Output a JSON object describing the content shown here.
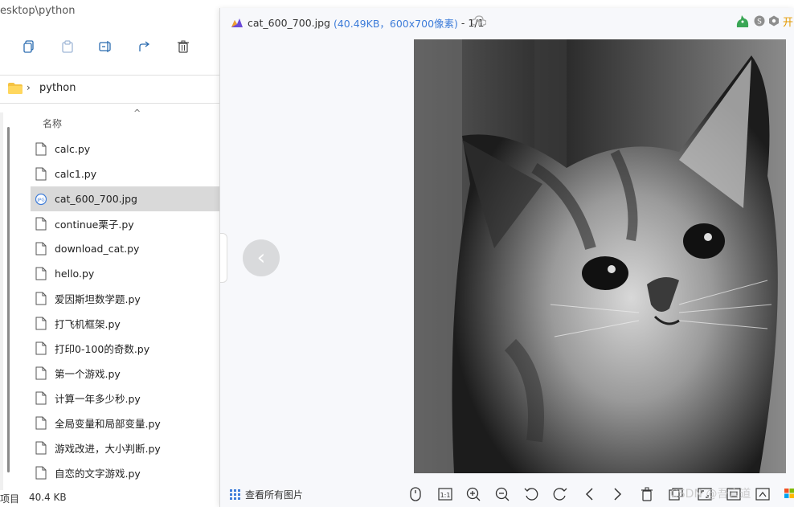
{
  "explorer": {
    "title": "esktop\\python",
    "breadcrumb": "python",
    "column_header": "名称",
    "files": [
      {
        "name": "calc.py",
        "type": "py",
        "selected": false
      },
      {
        "name": "calc1.py",
        "type": "py",
        "selected": false
      },
      {
        "name": "cat_600_700.jpg",
        "type": "jpg",
        "selected": true
      },
      {
        "name": "continue栗子.py",
        "type": "py",
        "selected": false
      },
      {
        "name": "download_cat.py",
        "type": "py",
        "selected": false
      },
      {
        "name": "hello.py",
        "type": "py",
        "selected": false
      },
      {
        "name": "爱因斯坦数学题.py",
        "type": "py",
        "selected": false
      },
      {
        "name": "打飞机框架.py",
        "type": "py",
        "selected": false
      },
      {
        "name": "打印0-100的奇数.py",
        "type": "py",
        "selected": false
      },
      {
        "name": "第一个游戏.py",
        "type": "py",
        "selected": false
      },
      {
        "name": "计算一年多少秒.py",
        "type": "py",
        "selected": false
      },
      {
        "name": "全局变量和局部变量.py",
        "type": "py",
        "selected": false
      },
      {
        "name": "游戏改进，大小判断.py",
        "type": "py",
        "selected": false
      },
      {
        "name": "自恋的文字游戏.py",
        "type": "py",
        "selected": false
      }
    ],
    "status": {
      "items": "项目",
      "size": "40.4 KB"
    }
  },
  "viewer": {
    "filename": "cat_600_700.jpg",
    "meta": "(40.49KB，600x700像素)",
    "counter": "- 1/1",
    "top_right_label": "开",
    "view_all_label": "查看所有图片",
    "watermark": "CSDN @吾言道",
    "bottom_icons": [
      "mouse-icon",
      "actual-size-icon",
      "zoom-in-icon",
      "zoom-out-icon",
      "rotate-left-icon",
      "rotate-right-icon",
      "previous-icon",
      "next-icon",
      "delete-icon",
      "window-icon",
      "fullscreen-icon",
      "scan-icon",
      "crop-icon",
      "edit-icon"
    ],
    "accent_color": "#3d7cd9"
  }
}
